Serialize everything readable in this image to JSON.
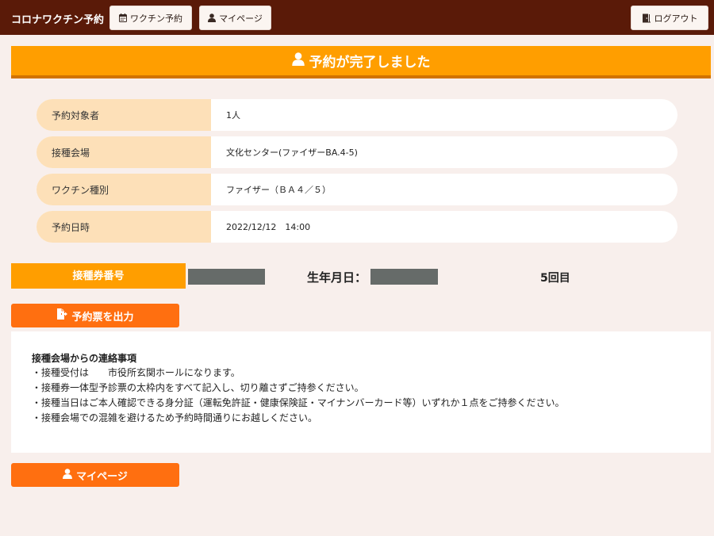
{
  "navbar": {
    "brand": "コロナワクチン予約",
    "vaccine_label": "ワクチン予約",
    "mypage_label": "マイページ",
    "logout_label": "ログアウト"
  },
  "page_title": "予約が完了しました",
  "details": [
    {
      "label": "予約対象者",
      "value": "1人"
    },
    {
      "label": "接種会場",
      "value": "文化センター(ファイザーBA.4-5)"
    },
    {
      "label": "ワクチン種別",
      "value": "ファイザー（ＢＡ４／５）"
    },
    {
      "label": "予約日時",
      "value": "2022/12/12　14:00"
    }
  ],
  "ticket": {
    "label": "接種券番号",
    "dob_label": "生年月日：",
    "dose": "5回目"
  },
  "buttons": {
    "print": "予約票を出力",
    "mypage": "マイページ"
  },
  "notice": {
    "title": "接種会場からの連絡事項",
    "lines": [
      "・接種受付は　　市役所玄関ホールになります。",
      "・接種券一体型予診票の太枠内をすべて記入し、切り離さずご持参ください。",
      "・接種当日はご本人確認できる身分証（運転免許証・健康保険証・マイナンバーカード等）いずれか１点をご持参ください。",
      "・接種会場での混雑を避けるため予約時間通りにお越しください。"
    ]
  },
  "colors": {
    "navbar": "#5a1a08",
    "title_bar": "#ff9e00",
    "action_button": "#ff6f10",
    "label_bg": "#fde0b8",
    "page_bg": "#f8efec"
  },
  "icons": {
    "vaccine": "calendar-icon",
    "mypage": "user-icon",
    "logout": "door-exit-icon",
    "title": "user-icon",
    "print": "file-export-icon"
  }
}
